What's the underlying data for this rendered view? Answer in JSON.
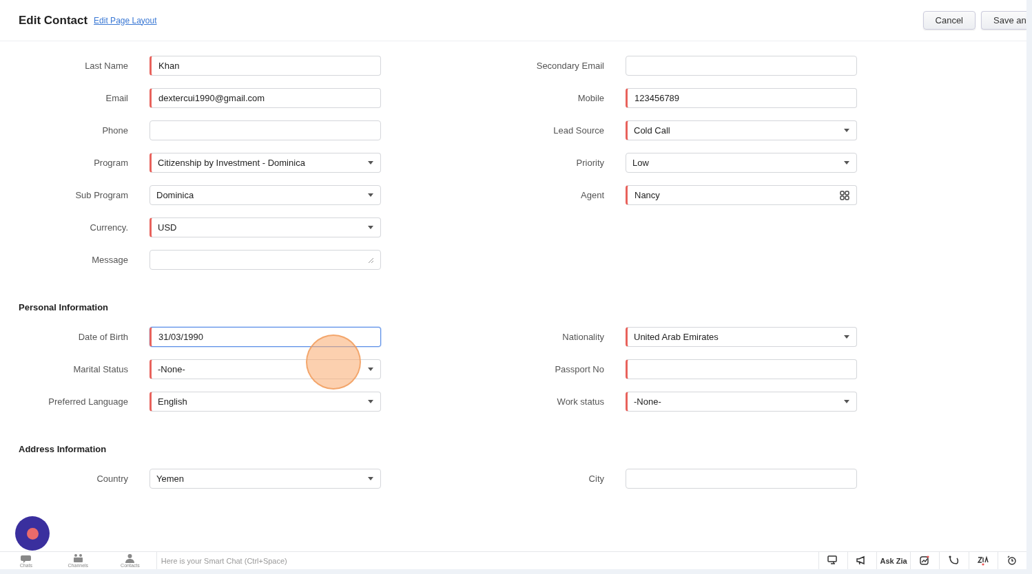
{
  "header": {
    "title": "Edit Contact",
    "layout_link": "Edit Page Layout",
    "buttons": [
      {
        "label": "Cancel"
      },
      {
        "label": "Save an"
      }
    ]
  },
  "sections": [
    {
      "left": [
        {
          "label": "Last Name",
          "value": "Khan",
          "kind": "text",
          "required": true,
          "focused": false
        },
        {
          "label": "Email",
          "value": "dextercui1990@gmail.com",
          "kind": "text",
          "required": true,
          "focused": false
        },
        {
          "label": "Phone",
          "kind": "text",
          "required": false,
          "focused": false
        },
        {
          "label": "Program",
          "value": "Citizenship by Investment - Dominica",
          "kind": "select",
          "required": true,
          "focused": false
        },
        {
          "label": "Sub Program",
          "value": "Dominica",
          "kind": "select",
          "required": false,
          "focused": false
        },
        {
          "label": "Currency.",
          "value": "USD",
          "kind": "select",
          "required": true,
          "focused": false
        },
        {
          "label": "Message",
          "kind": "textarea",
          "required": false,
          "focused": false
        }
      ],
      "right": [
        {
          "label": "Secondary Email",
          "kind": "text",
          "required": false,
          "focused": false
        },
        {
          "label": "Mobile",
          "value": "123456789",
          "kind": "text",
          "required": true,
          "focused": false
        },
        {
          "label": "Lead Source",
          "value": "Cold Call",
          "kind": "select",
          "required": true,
          "focused": false
        },
        {
          "label": "Priority",
          "value": "Low",
          "kind": "select",
          "required": false,
          "focused": false
        },
        {
          "label": "Agent",
          "value": "Nancy",
          "kind": "lookup",
          "required": true,
          "focused": false
        }
      ]
    },
    {
      "title": "Personal Information",
      "left": [
        {
          "label": "Date of Birth",
          "value": "31/03/1990",
          "kind": "text",
          "required": true,
          "focused": true
        },
        {
          "label": "Marital Status",
          "value": "-None-",
          "kind": "select",
          "required": true,
          "focused": false
        },
        {
          "label": "Preferred Language",
          "value": "English",
          "kind": "select",
          "required": true,
          "focused": false
        }
      ],
      "right": [
        {
          "label": "Nationality",
          "value": "United Arab Emirates",
          "kind": "select",
          "required": true,
          "focused": false
        },
        {
          "label": "Passport No",
          "kind": "text",
          "required": true,
          "focused": false
        },
        {
          "label": "Work status",
          "value": "-None-",
          "kind": "select",
          "required": true,
          "focused": false
        }
      ]
    },
    {
      "title": "Address Information",
      "left": [
        {
          "label": "Country",
          "value": "Yemen",
          "kind": "select",
          "required": false,
          "focused": false
        }
      ],
      "right": [
        {
          "label": "City",
          "kind": "text",
          "required": false,
          "focused": false
        }
      ]
    }
  ],
  "bottom_bar": {
    "tabs": [
      {
        "label": "Chats",
        "kind": "chats"
      },
      {
        "label": "Channels",
        "kind": "channels"
      },
      {
        "label": "Contacts",
        "kind": "contacts"
      }
    ],
    "chat_placeholder": "Here is your Smart Chat (Ctrl+Space)",
    "tools": [
      {
        "kind": "screen"
      },
      {
        "kind": "announce"
      },
      {
        "kind": "text",
        "label": "Ask Zia"
      },
      {
        "kind": "chart"
      },
      {
        "kind": "flow"
      },
      {
        "kind": "zia"
      },
      {
        "kind": "clock"
      }
    ]
  }
}
